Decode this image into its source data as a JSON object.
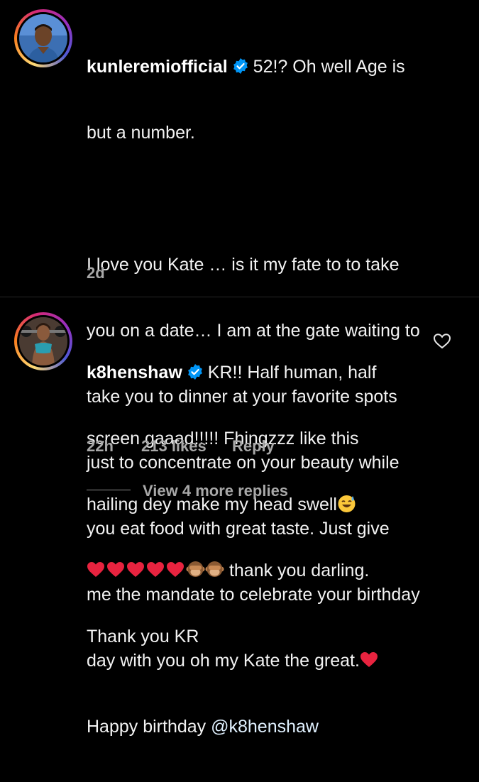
{
  "comment1": {
    "username": "kunleremiofficial",
    "text_a": "52!? Oh well Age is",
    "text_b": "but a number.",
    "text_c": "I love you Kate … is it my fate to to take",
    "text_d": "you on a date… I am at the gate waiting to",
    "text_e": "take you to dinner at your favorite spots",
    "text_f": "just to concentrate on your beauty while",
    "text_g": "you eat food with great taste. Just give",
    "text_h": "me the mandate to celebrate your birthday",
    "text_i": "day with you oh my Kate the great.",
    "text_j": "Happy birthday ",
    "mention": "@k8henshaw",
    "time": "2d"
  },
  "comment2": {
    "username": "k8henshaw",
    "text_a": "KR!! Half human, half",
    "text_b": "screen gaaad!!!!! Fhingzzz like this",
    "text_c": "hailing dey make my head swell",
    "text_d": " thank you darling.",
    "text_e": "Thank you KR",
    "time": "22h",
    "likes": "213 likes",
    "reply": "Reply",
    "view_replies": "View 4 more replies"
  },
  "icons": {
    "verified": "verified-badge-icon",
    "heart": "red-heart-emoji",
    "monkey": "see-no-evil-monkey-emoji",
    "sweat": "grinning-sweat-emoji",
    "like": "heart-outline-icon"
  },
  "colors": {
    "background": "#000000",
    "verified": "#0095f6",
    "heart": "#e8233f",
    "muted": "#a8a8a8"
  }
}
